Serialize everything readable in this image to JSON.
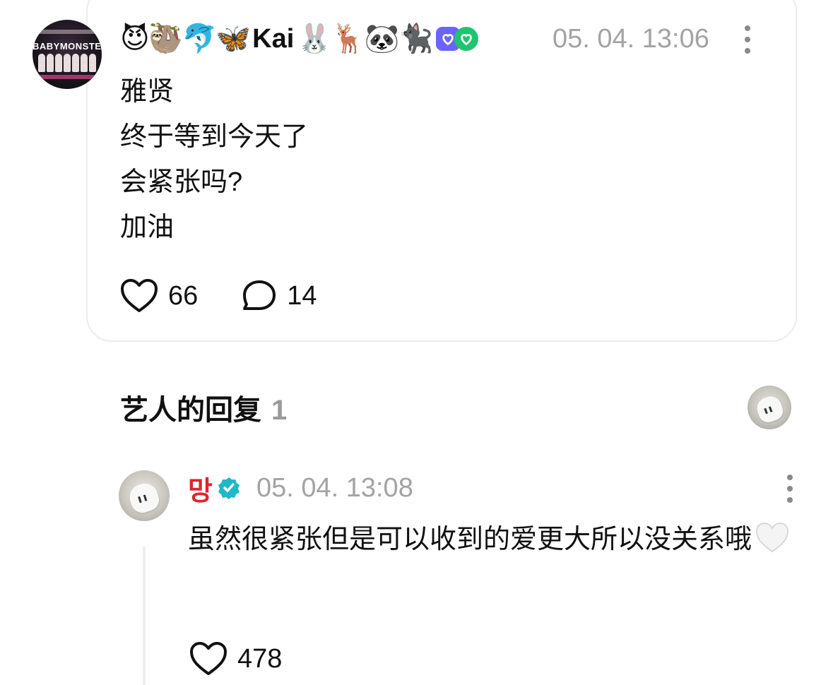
{
  "post": {
    "author_avatar_text": "BABYMONSTER",
    "emoji_before": "😈🦥🐬🦋",
    "username": "Kai",
    "emoji_after": "🐰🦌🐼🐈‍⬛",
    "timestamp": "05. 04. 13:06",
    "body_lines": [
      "雅贤",
      "终于等到今天了",
      "会紧张吗?",
      "加油"
    ],
    "like_count": "66",
    "comment_count": "14"
  },
  "artist_replies": {
    "title": "艺人的回复",
    "count": "1"
  },
  "reply": {
    "author": "망",
    "timestamp": "05. 04. 13:08",
    "body": "虽然很紧张但是可以收到的爱更大所以没关系哦",
    "like_count": "478"
  },
  "icons": {
    "more": "more-vertical-icon",
    "like": "heart-outline-icon",
    "comment": "comment-bubble-icon",
    "verified": "verified-badge-icon",
    "reply_emoji": "white-heart-icon"
  },
  "colors": {
    "artist_name": "#e0242e",
    "timestamp": "#a3a3a3",
    "verified": "#1fb8c8",
    "card_border": "#ececec"
  }
}
